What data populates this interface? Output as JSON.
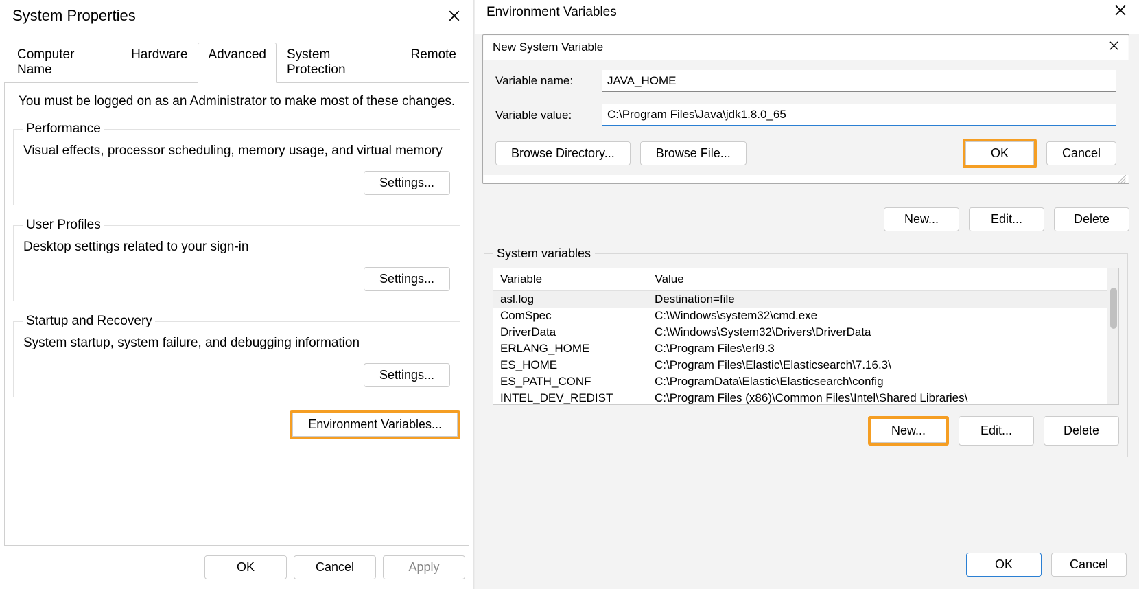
{
  "sysprops": {
    "title": "System Properties",
    "tabs": {
      "computer_name": "Computer Name",
      "hardware": "Hardware",
      "advanced": "Advanced",
      "system_protection": "System Protection",
      "remote": "Remote"
    },
    "admin_note": "You must be logged on as an Administrator to make most of these changes.",
    "performance": {
      "legend": "Performance",
      "text": "Visual effects, processor scheduling, memory usage, and virtual memory",
      "settings_btn": "Settings..."
    },
    "user_profiles": {
      "legend": "User Profiles",
      "text": "Desktop settings related to your sign-in",
      "settings_btn": "Settings..."
    },
    "startup": {
      "legend": "Startup and Recovery",
      "text": "System startup, system failure, and debugging information",
      "settings_btn": "Settings..."
    },
    "envvars_btn": "Environment Variables...",
    "footer": {
      "ok": "OK",
      "cancel": "Cancel",
      "apply": "Apply"
    }
  },
  "envvars": {
    "title": "Environment Variables",
    "nsv": {
      "title": "New System Variable",
      "name_label": "Variable name:",
      "name_value": "JAVA_HOME",
      "value_label": "Variable value:",
      "value_value": "C:\\Program Files\\Java\\jdk1.8.0_65",
      "browse_dir": "Browse Directory...",
      "browse_file": "Browse File...",
      "ok": "OK",
      "cancel": "Cancel"
    },
    "user_btns": {
      "new": "New...",
      "edit": "Edit...",
      "delete": "Delete"
    },
    "sysvars": {
      "legend": "System variables",
      "col_variable": "Variable",
      "col_value": "Value",
      "rows": [
        {
          "var": "asl.log",
          "val": "Destination=file"
        },
        {
          "var": "ComSpec",
          "val": "C:\\Windows\\system32\\cmd.exe"
        },
        {
          "var": "DriverData",
          "val": "C:\\Windows\\System32\\Drivers\\DriverData"
        },
        {
          "var": "ERLANG_HOME",
          "val": "C:\\Program Files\\erl9.3"
        },
        {
          "var": "ES_HOME",
          "val": "C:\\Program Files\\Elastic\\Elasticsearch\\7.16.3\\"
        },
        {
          "var": "ES_PATH_CONF",
          "val": "C:\\ProgramData\\Elastic\\Elasticsearch\\config"
        },
        {
          "var": "INTEL_DEV_REDIST",
          "val": "C:\\Program Files (x86)\\Common Files\\Intel\\Shared Libraries\\"
        }
      ],
      "btns": {
        "new": "New...",
        "edit": "Edit...",
        "delete": "Delete"
      }
    },
    "footer": {
      "ok": "OK",
      "cancel": "Cancel"
    }
  }
}
